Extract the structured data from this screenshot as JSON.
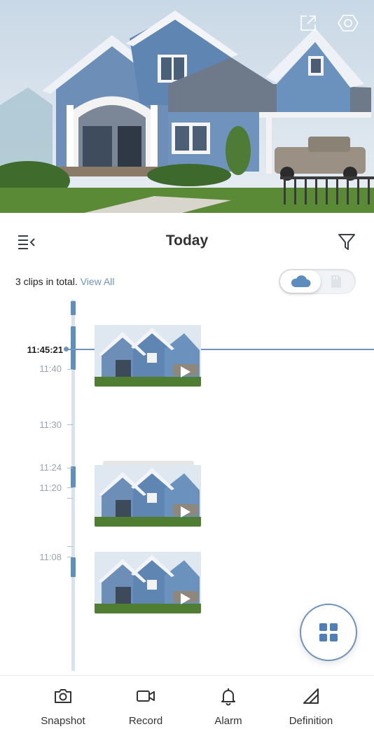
{
  "preview": {
    "share_icon": "external-link-icon",
    "settings_icon": "hexagon-gear-icon"
  },
  "header": {
    "title": "Today",
    "menu_icon": "collapse-menu-icon",
    "filter_icon": "filter-icon"
  },
  "clips_info": {
    "total_text": "3 clips in total.",
    "view_all": "View All"
  },
  "storage_toggle": {
    "selected": "cloud",
    "options": [
      "cloud-icon",
      "sd-card-icon"
    ]
  },
  "timeline": {
    "current_time": "11:45:21",
    "time_labels": [
      "11:40",
      "11:30",
      "11:24",
      "11:20",
      "11:08"
    ],
    "clips": [
      {
        "name": "clip-1",
        "icon": "play-icon"
      },
      {
        "name": "clip-2",
        "icon": "play-icon"
      },
      {
        "name": "clip-3",
        "icon": "play-icon"
      }
    ]
  },
  "fab": {
    "icon": "grid-icon"
  },
  "bottom_bar": {
    "items": [
      {
        "label": "Snapshot",
        "icon": "camera-icon"
      },
      {
        "label": "Record",
        "icon": "video-camera-icon"
      },
      {
        "label": "Alarm",
        "icon": "bell-icon"
      },
      {
        "label": "Definition",
        "icon": "definition-icon"
      }
    ]
  },
  "colors": {
    "accent": "#6f93bd",
    "segment": "#5f8fc0",
    "text": "#222222",
    "muted": "#9aa3ad"
  }
}
